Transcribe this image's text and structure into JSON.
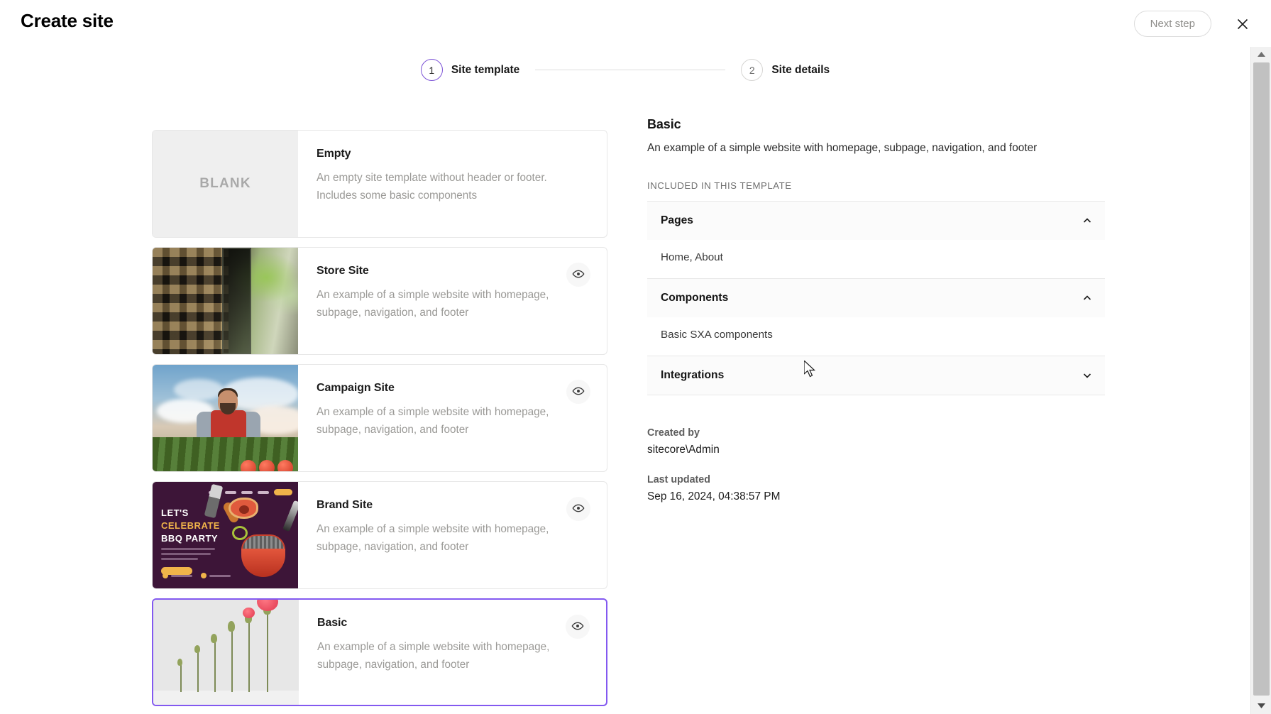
{
  "header": {
    "title": "Create site",
    "next_step_label": "Next step",
    "close_icon": "close-icon"
  },
  "stepper": {
    "steps": [
      {
        "number": "1",
        "label": "Site template",
        "state": "active"
      },
      {
        "number": "2",
        "label": "Site details",
        "state": "inactive"
      }
    ]
  },
  "templates": [
    {
      "name": "Empty",
      "description": "An empty site template without header or footer. Includes some basic components",
      "thumb_label": "BLANK",
      "thumb_kind": "blank",
      "has_preview": false,
      "selected": false
    },
    {
      "name": "Store Site",
      "description": "An example of a simple website with homepage, subpage, navigation, and footer",
      "thumb_label": "",
      "thumb_kind": "store",
      "has_preview": true,
      "preview_icon": "eye-icon",
      "selected": false
    },
    {
      "name": "Campaign Site",
      "description": "An example of a simple website with homepage, subpage, navigation, and footer",
      "thumb_label": "",
      "thumb_kind": "campaign",
      "has_preview": true,
      "preview_icon": "eye-icon",
      "selected": false
    },
    {
      "name": "Brand Site",
      "description": "An example of a simple website with homepage, subpage, navigation, and footer",
      "thumb_label": "",
      "thumb_kind": "brand",
      "thumb_text": {
        "line1": "LET'S",
        "line2": "CELEBRATE",
        "line3": "BBQ PARTY"
      },
      "has_preview": true,
      "preview_icon": "eye-icon",
      "selected": false
    },
    {
      "name": "Basic",
      "description": "An example of a simple website with homepage, subpage, navigation, and footer",
      "thumb_label": "",
      "thumb_kind": "basic",
      "has_preview": true,
      "preview_icon": "eye-icon",
      "selected": true
    }
  ],
  "detail": {
    "title": "Basic",
    "description": "An example of a simple website with homepage, subpage, navigation, and footer",
    "included_label": "INCLUDED IN THIS TEMPLATE",
    "sections": [
      {
        "title": "Pages",
        "expanded": true,
        "body": "Home, About",
        "chevron": "chevron-up-icon"
      },
      {
        "title": "Components",
        "expanded": true,
        "body": "Basic SXA components",
        "chevron": "chevron-up-icon"
      },
      {
        "title": "Integrations",
        "expanded": false,
        "body": "",
        "chevron": "chevron-down-icon"
      }
    ],
    "created_by_label": "Created by",
    "created_by_value": "sitecore\\Admin",
    "last_updated_label": "Last updated",
    "last_updated_value": "Sep 16, 2024, 04:38:57 PM"
  },
  "colors": {
    "accent_purple": "#8359f0",
    "step_active": "#7b52d6",
    "card_border": "#e7e7e7",
    "muted_text": "#9a9996"
  },
  "scrollbar": {
    "up_icon": "scroll-up-arrow-icon",
    "down_icon": "scroll-down-arrow-icon"
  }
}
